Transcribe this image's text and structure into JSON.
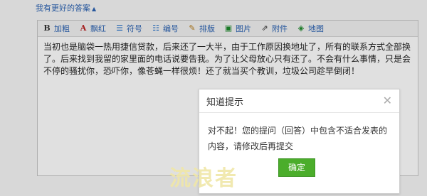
{
  "toggle_link": "我有更好的答案",
  "toolbar": {
    "items": [
      {
        "icon": "bold-icon",
        "glyph": "B",
        "label": "加粗"
      },
      {
        "icon": "font-color-icon",
        "glyph": "A",
        "label": "飘红"
      },
      {
        "icon": "list-bullet-icon",
        "glyph": "☰",
        "label": "符号"
      },
      {
        "icon": "list-number-icon",
        "glyph": "☷",
        "label": "编号"
      },
      {
        "icon": "magic-wand-icon",
        "glyph": "✎",
        "label": "排版"
      },
      {
        "icon": "image-icon",
        "glyph": "▣",
        "label": "图片"
      },
      {
        "icon": "attachment-icon",
        "glyph": "⇗",
        "label": "附件"
      },
      {
        "icon": "map-icon",
        "glyph": "◈",
        "label": "地图"
      }
    ]
  },
  "editor": {
    "text": "当初也是脑袋一热用捷信贷款，后来还了一大半，由于工作原因换地址了，所有的联系方式全部换了。后来找到我留的家里面的电话说要告我。为了让父母放心只有还了。不会有什么事情，只是会不停的骚扰你，恐吓你，像苍蝇一样很烦！还了就当买个教训，垃圾公司趁早倒闭！"
  },
  "dialog": {
    "title": "知道提示",
    "message": "对不起！您的提问（回答）中包含不适合发表的内容，请修改后再提交",
    "confirm": "确定"
  },
  "watermark": "流浪者",
  "colors": {
    "accent": "#4bad2b",
    "link": "#2d64b3"
  }
}
